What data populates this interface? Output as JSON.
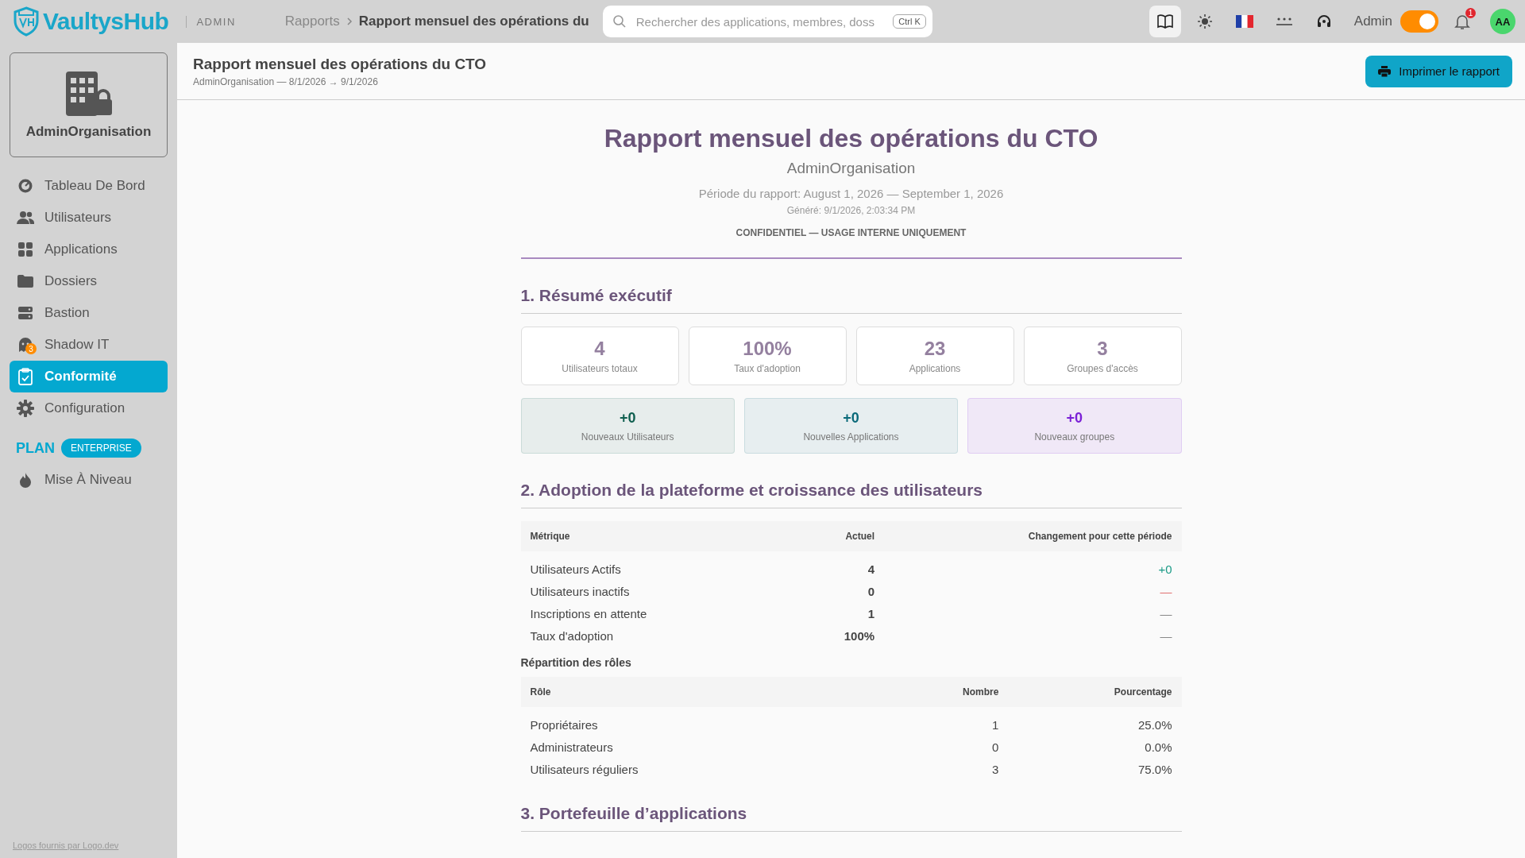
{
  "topbar": {
    "brand": "VaultysHub",
    "section": "ADMIN",
    "breadcrumb": [
      "Rapports",
      "Rapport mensuel des opérations du"
    ],
    "search": {
      "placeholder": "Rechercher des applications, membres, doss",
      "shortcut": "Ctrl K"
    },
    "user": "Admin",
    "admin_mode": {
      "on": true
    },
    "notifications": "1",
    "avatar": "AA"
  },
  "sidebar": {
    "org": "AdminOrganisation",
    "items": [
      {
        "label": "Tableau De Bord",
        "kind": "gauge",
        "selected": false
      },
      {
        "label": "Utilisateurs",
        "kind": "users",
        "selected": false
      },
      {
        "label": "Applications",
        "kind": "grid",
        "selected": false
      },
      {
        "label": "Dossiers",
        "kind": "folder",
        "selected": false
      },
      {
        "label": "Bastion",
        "kind": "server",
        "selected": false
      },
      {
        "label": "Shadow IT",
        "kind": "ghost",
        "selected": false,
        "badge": "3"
      },
      {
        "label": "Conformité",
        "kind": "clipboard",
        "selected": true
      },
      {
        "label": "Configuration",
        "kind": "gear",
        "selected": false
      }
    ],
    "plan": {
      "label": "PLAN",
      "tier": "ENTERPRISE"
    },
    "upgrade": "Mise À Niveau",
    "footer_link": "Logos fournis par Logo.dev"
  },
  "header": {
    "title": "Rapport mensuel des opérations du CTO",
    "subtitle": "AdminOrganisation — 8/1/2026 → 9/1/2026",
    "print_button": "Imprimer le rapport"
  },
  "report": {
    "title": "Rapport mensuel des opérations du CTO",
    "org": "AdminOrganisation",
    "period": "Période du rapport: August 1, 2026 — September 1, 2026",
    "generated": "Généré: 9/1/2026, 2:03:34 PM",
    "confidential": "CONFIDENTIEL — USAGE INTERNE UNIQUEMENT",
    "section1": {
      "title": "1. Résumé exécutif",
      "stats": [
        {
          "value": "4",
          "label": "Utilisateurs totaux"
        },
        {
          "value": "100%",
          "label": "Taux d'adoption"
        },
        {
          "value": "23",
          "label": "Applications"
        },
        {
          "value": "3",
          "label": "Groupes d'accès"
        }
      ],
      "changes": [
        {
          "value": "+0",
          "label": "Nouveaux Utilisateurs",
          "color": "#0f5f4f"
        },
        {
          "value": "+0",
          "label": "Nouvelles Applications",
          "color": "#0b6a7a"
        },
        {
          "value": "+0",
          "label": "Nouveaux groupes",
          "color": "#7a1fd6"
        }
      ]
    },
    "section2": {
      "title": "2. Adoption de la plateforme et croissance des utilisateurs",
      "metrics": {
        "columns": [
          "Métrique",
          "Actuel",
          "Changement pour cette période"
        ],
        "rows": [
          {
            "metric": "Utilisateurs Actifs",
            "current": "4",
            "change": "+0",
            "kind": "positive"
          },
          {
            "metric": "Utilisateurs inactifs",
            "current": "0",
            "change": "—",
            "kind": "negative"
          },
          {
            "metric": "Inscriptions en attente",
            "current": "1",
            "change": "—",
            "kind": "neutral"
          },
          {
            "metric": "Taux d'adoption",
            "current": "100%",
            "change": "—",
            "kind": "neutral"
          }
        ]
      },
      "roles_title": "Répartition des rôles",
      "roles": {
        "columns": [
          "Rôle",
          "Nombre",
          "Pourcentage"
        ],
        "rows": [
          {
            "role": "Propriétaires",
            "count": "1",
            "percent": "25.0%"
          },
          {
            "role": "Administrateurs",
            "count": "0",
            "percent": "0.0%"
          },
          {
            "role": "Utilisateurs réguliers",
            "count": "3",
            "percent": "75.0%"
          }
        ]
      }
    },
    "section3": {
      "title": "3. Portefeuille d’applications"
    }
  }
}
